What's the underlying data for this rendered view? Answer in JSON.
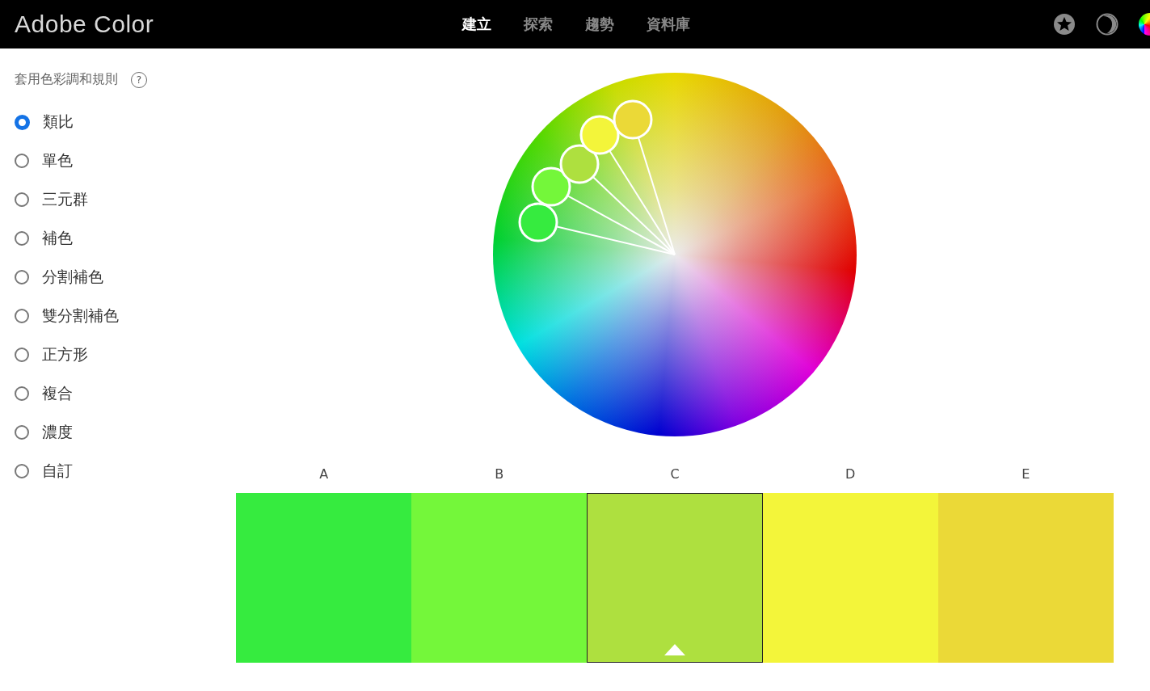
{
  "header": {
    "logo": "Adobe Color",
    "tabs": [
      {
        "label": "建立",
        "selected": true
      },
      {
        "label": "探索",
        "selected": false
      },
      {
        "label": "趨勢",
        "selected": false
      },
      {
        "label": "資料庫",
        "selected": false
      }
    ]
  },
  "sidebar": {
    "title": "套用色彩調和規則",
    "help": "?",
    "rules": [
      {
        "label": "類比",
        "selected": true
      },
      {
        "label": "單色",
        "selected": false
      },
      {
        "label": "三元群",
        "selected": false
      },
      {
        "label": "補色",
        "selected": false
      },
      {
        "label": "分割補色",
        "selected": false
      },
      {
        "label": "雙分割補色",
        "selected": false
      },
      {
        "label": "正方形",
        "selected": false
      },
      {
        "label": "複合",
        "selected": false
      },
      {
        "label": "濃度",
        "selected": false
      },
      {
        "label": "自訂",
        "selected": false
      }
    ]
  },
  "swatches": [
    {
      "label": "A",
      "color": "#36eb3f",
      "selected": false
    },
    {
      "label": "B",
      "color": "#74f73a",
      "selected": false
    },
    {
      "label": "C",
      "color": "#aee03f",
      "selected": true
    },
    {
      "label": "D",
      "color": "#f3f53a",
      "selected": false
    },
    {
      "label": "E",
      "color": "#ebd937",
      "selected": false
    }
  ]
}
